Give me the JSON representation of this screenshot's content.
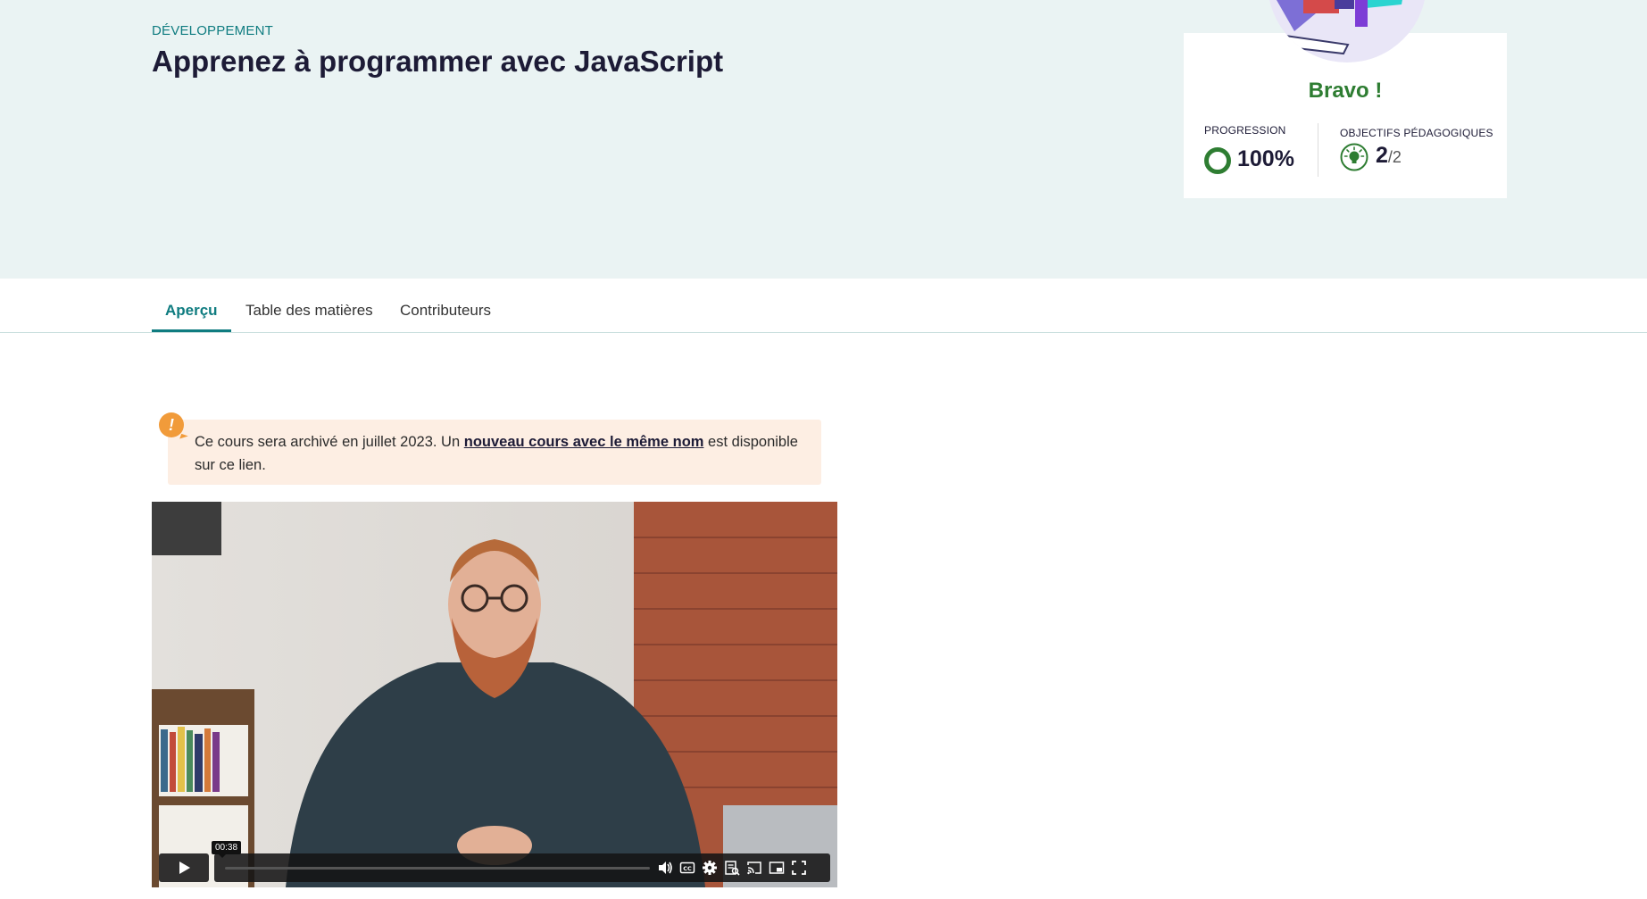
{
  "header": {
    "category": "DÉVELOPPEMENT",
    "title": "Apprenez à programmer avec JavaScript"
  },
  "progress_card": {
    "bravo": "Bravo !",
    "progression_label": "PROGRESSION",
    "progression_value": "100%",
    "progression_fraction": 1.0,
    "objectives_label": "OBJECTIFS PÉDAGOGIQUES",
    "objectives_done": "2",
    "objectives_total": "/2",
    "progress_color": "#2e7d32"
  },
  "tabs": [
    {
      "label": "Aperçu",
      "active": true
    },
    {
      "label": "Table des matières",
      "active": false
    },
    {
      "label": "Contributeurs",
      "active": false
    }
  ],
  "notice": {
    "badge": "!",
    "text_before": "Ce cours sera archivé en juillet 2023. Un ",
    "link": "nouveau cours avec le même nom",
    "text_after": " est disponible sur ce lien."
  },
  "video": {
    "time_tooltip": "00:38",
    "icons": [
      "play-icon",
      "volume-icon",
      "captions-icon",
      "settings-icon",
      "transcript-icon",
      "cast-icon",
      "picture-in-picture-icon",
      "fullscreen-icon"
    ]
  },
  "colors": {
    "accent": "#0f7c80",
    "hero_bg": "#eaf3f3",
    "notice_bg": "#fdeee3",
    "notice_badge": "#f19b3a"
  }
}
